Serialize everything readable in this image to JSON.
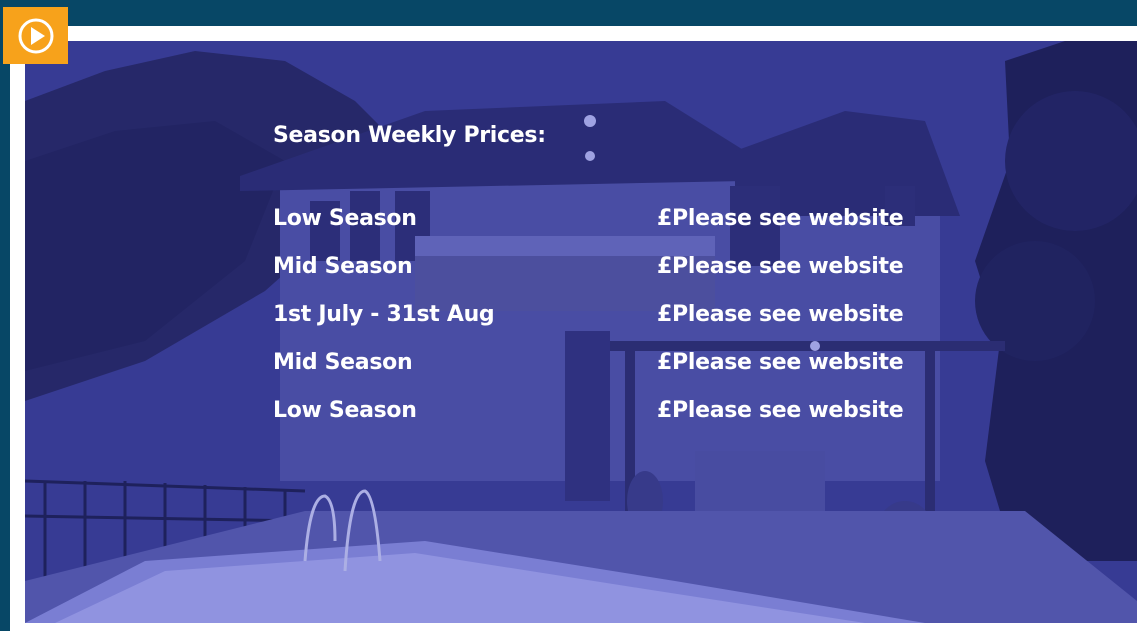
{
  "play_button": {
    "icon": "play-circle-icon",
    "color": "#f7a21b"
  },
  "colors": {
    "frame": "#074766",
    "overlay": "#3e4399",
    "accent": "#f7a21b"
  },
  "prices": {
    "title": "Season Weekly Prices:",
    "rows": [
      {
        "season": "Low Season",
        "price": "£Please see website"
      },
      {
        "season": "Mid Season",
        "price": "£Please see website"
      },
      {
        "season": "1st July - 31st Aug",
        "price": "£Please see website"
      },
      {
        "season": "Mid Season",
        "price": "£Please see website"
      },
      {
        "season": "Low Season",
        "price": "£Please see website"
      }
    ]
  }
}
